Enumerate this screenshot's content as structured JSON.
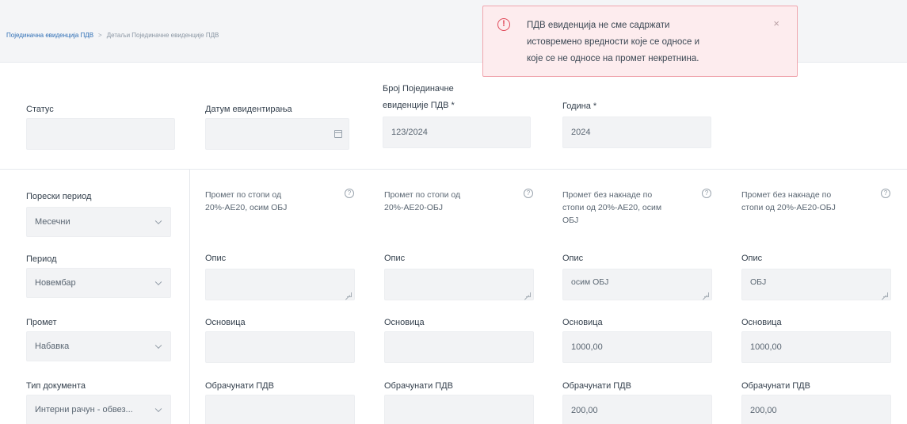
{
  "breadcrumb": {
    "link": "Појединачна евиденција ПДВ",
    "separator": ">",
    "current": "Детаљи Појединачне евиденције ПДВ"
  },
  "header_fields": {
    "status": {
      "label": "Статус",
      "value": ""
    },
    "datum": {
      "label": "Датум евидентирања",
      "value": ""
    },
    "broj": {
      "label_line1": "Број Појединачне",
      "label_line2": "евиденције ПДВ *",
      "value": "123/2024"
    },
    "godina": {
      "label": "Година *",
      "value": "2024"
    }
  },
  "left_panel": {
    "poreski_period": {
      "label": "Порески период",
      "value": "Месечни"
    },
    "period": {
      "label": "Период",
      "value": "Новембар"
    },
    "promet": {
      "label": "Промет",
      "value": "Набавка"
    },
    "tip_dokumenta": {
      "label": "Тип документа",
      "value": "Интерни рачун - обвез..."
    }
  },
  "columns": [
    {
      "title_line1": "Промет по стопи од",
      "title_line2": "20%-АЕ20, осим ОБЈ",
      "title_line3": "",
      "opis_label": "Опис",
      "opis_value": "",
      "osnovica_label": "Основица",
      "osnovica_value": "",
      "pdv_label": "Обрачунати ПДВ",
      "pdv_value": ""
    },
    {
      "title_line1": "Промет по стопи од",
      "title_line2": "20%-АЕ20-ОБЈ",
      "title_line3": "",
      "opis_label": "Опис",
      "opis_value": "",
      "osnovica_label": "Основица",
      "osnovica_value": "",
      "pdv_label": "Обрачунати ПДВ",
      "pdv_value": ""
    },
    {
      "title_line1": "Промет без накнаде по",
      "title_line2": "стопи од 20%-АЕ20, осим",
      "title_line3": "ОБЈ",
      "opis_label": "Опис",
      "opis_value": "осим ОБЈ",
      "osnovica_label": "Основица",
      "osnovica_value": "1000,00",
      "pdv_label": "Обрачунати ПДВ",
      "pdv_value": "200,00"
    },
    {
      "title_line1": "Промет без накнаде по",
      "title_line2": "стопи од 20%-АЕ20-ОБЈ",
      "title_line3": "",
      "opis_label": "Опис",
      "opis_value": "ОБЈ",
      "osnovica_label": "Основица",
      "osnovica_value": "1000,00",
      "pdv_label": "Обрачунати ПДВ",
      "pdv_value": "200,00"
    }
  ],
  "toast": {
    "line1": "ПДВ евиденција не сме садржати",
    "line2": "истовремено вредности које се односе и",
    "line3": "које се не односе на промет некретнина.",
    "close": "×",
    "icon": "!"
  },
  "colors": {
    "accent": "#2f6fb5",
    "error_border": "#f0a6ae",
    "error_bg": "#fdecee",
    "error_icon": "#e04a5a"
  }
}
